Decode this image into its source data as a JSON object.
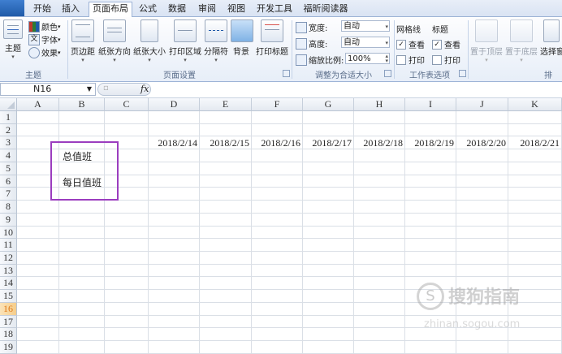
{
  "ribbon": {
    "tabs": [
      "开始",
      "插入",
      "页面布局",
      "公式",
      "数据",
      "审阅",
      "视图",
      "开发工具",
      "福昕阅读器"
    ],
    "active_tab": "页面布局",
    "theme_group": {
      "theme_label": "主题",
      "colors_label": "颜色",
      "fonts_label": "字体",
      "effects_label": "效果",
      "group_label": "主题"
    },
    "page_setup": {
      "margins": "页边距",
      "orientation": "纸张方向",
      "size": "纸张大小",
      "print_area": "打印区域",
      "breaks": "分隔符",
      "background": "背景",
      "print_titles": "打印标题",
      "group_label": "页面设置"
    },
    "scale": {
      "width_label": "宽度:",
      "width_value": "自动",
      "height_label": "高度:",
      "height_value": "自动",
      "scale_label": "缩放比例:",
      "scale_value": "100%",
      "group_label": "调整为合适大小"
    },
    "sheet_options": {
      "gridlines": "网格线",
      "headings": "标题",
      "view": "查看",
      "print": "打印",
      "group_label": "工作表选项"
    },
    "arrange": {
      "bring_forward": "置于顶层",
      "send_backward": "置于底层",
      "selection_pane": "选择窗格",
      "group_label": "排"
    }
  },
  "formula_bar": {
    "name_box": "N16",
    "fx": "fx",
    "formula": ""
  },
  "sheet": {
    "columns": [
      "A",
      "B",
      "C",
      "D",
      "E",
      "F",
      "G",
      "H",
      "I",
      "J",
      "K"
    ],
    "rows": [
      "1",
      "2",
      "3",
      "4",
      "5",
      "6",
      "7",
      "8",
      "9",
      "10",
      "11",
      "12",
      "13",
      "14",
      "15",
      "16",
      "17",
      "18",
      "19"
    ],
    "selected_row": "16",
    "dates": [
      "2018/2/14",
      "2018/2/15",
      "2018/2/16",
      "2018/2/17",
      "2018/2/18",
      "2018/2/19",
      "2018/2/20",
      "2018/2/21"
    ],
    "b4": "总值班",
    "b6": "每日值班",
    "highlight_color": "#9b3dbf"
  },
  "watermark": {
    "text": "搜狗指南",
    "sub": "zhinan.sogou.com"
  }
}
